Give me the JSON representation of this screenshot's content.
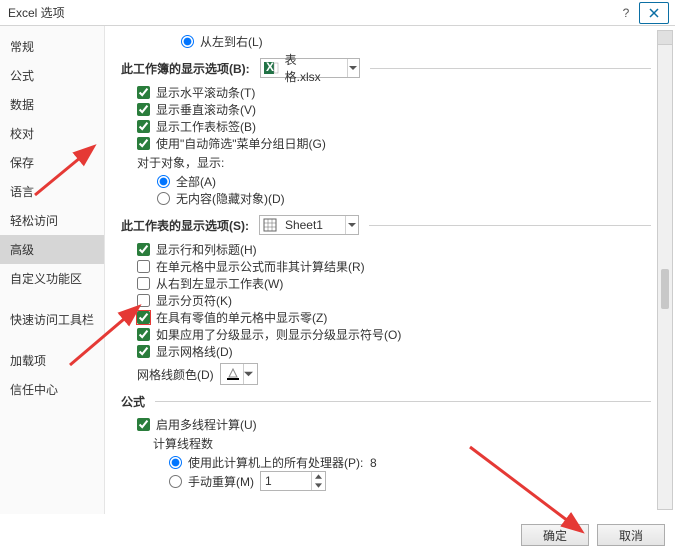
{
  "titlebar": {
    "title": "Excel 选项"
  },
  "sidebar": {
    "items": [
      {
        "label": "常规"
      },
      {
        "label": "公式"
      },
      {
        "label": "数据"
      },
      {
        "label": "校对"
      },
      {
        "label": "保存"
      },
      {
        "label": "语言"
      },
      {
        "label": "轻松访问"
      },
      {
        "label": "高级",
        "selected": true
      },
      {
        "label": "自定义功能区"
      },
      {
        "label": "快速访问工具栏"
      },
      {
        "label": "加载项"
      },
      {
        "label": "信任中心"
      }
    ]
  },
  "content": {
    "top_radio": "从左到右(L)",
    "workbook_section": {
      "label": "此工作簿的显示选项(B):",
      "dropdown_value": "表格.xlsx",
      "items": [
        {
          "label": "显示水平滚动条(T)",
          "checked": true
        },
        {
          "label": "显示垂直滚动条(V)",
          "checked": true
        },
        {
          "label": "显示工作表标签(B)",
          "checked": true
        },
        {
          "label": "使用\"自动筛选\"菜单分组日期(G)",
          "checked": true
        }
      ],
      "object_label": "对于对象，显示:",
      "radios": [
        {
          "label": "全部(A)",
          "checked": true
        },
        {
          "label": "无内容(隐藏对象)(D)",
          "checked": false
        }
      ]
    },
    "worksheet_section": {
      "label": "此工作表的显示选项(S):",
      "dropdown_value": "Sheet1",
      "items": [
        {
          "label": "显示行和列标题(H)",
          "checked": true
        },
        {
          "label": "在单元格中显示公式而非其计算结果(R)",
          "checked": false
        },
        {
          "label": "从右到左显示工作表(W)",
          "checked": false
        },
        {
          "label": "显示分页符(K)",
          "checked": false
        },
        {
          "label": "在具有零值的单元格中显示零(Z)",
          "checked": true,
          "highlight": true
        },
        {
          "label": "如果应用了分级显示，则显示分级显示符号(O)",
          "checked": true
        },
        {
          "label": "显示网格线(D)",
          "checked": true
        }
      ],
      "gridcolor_label": "网格线颜色(D)"
    },
    "formula_section": {
      "label": "公式",
      "multithread": {
        "label": "启用多线程计算(U)",
        "checked": true
      },
      "threads_label": "计算线程数",
      "radios": [
        {
          "label": "使用此计算机上的所有处理器(P):",
          "value": "8",
          "checked": true
        },
        {
          "label": "手动重算(M)",
          "checked": false
        }
      ],
      "spinner_value": "1"
    }
  },
  "footer": {
    "ok": "确定",
    "cancel": "取消"
  }
}
